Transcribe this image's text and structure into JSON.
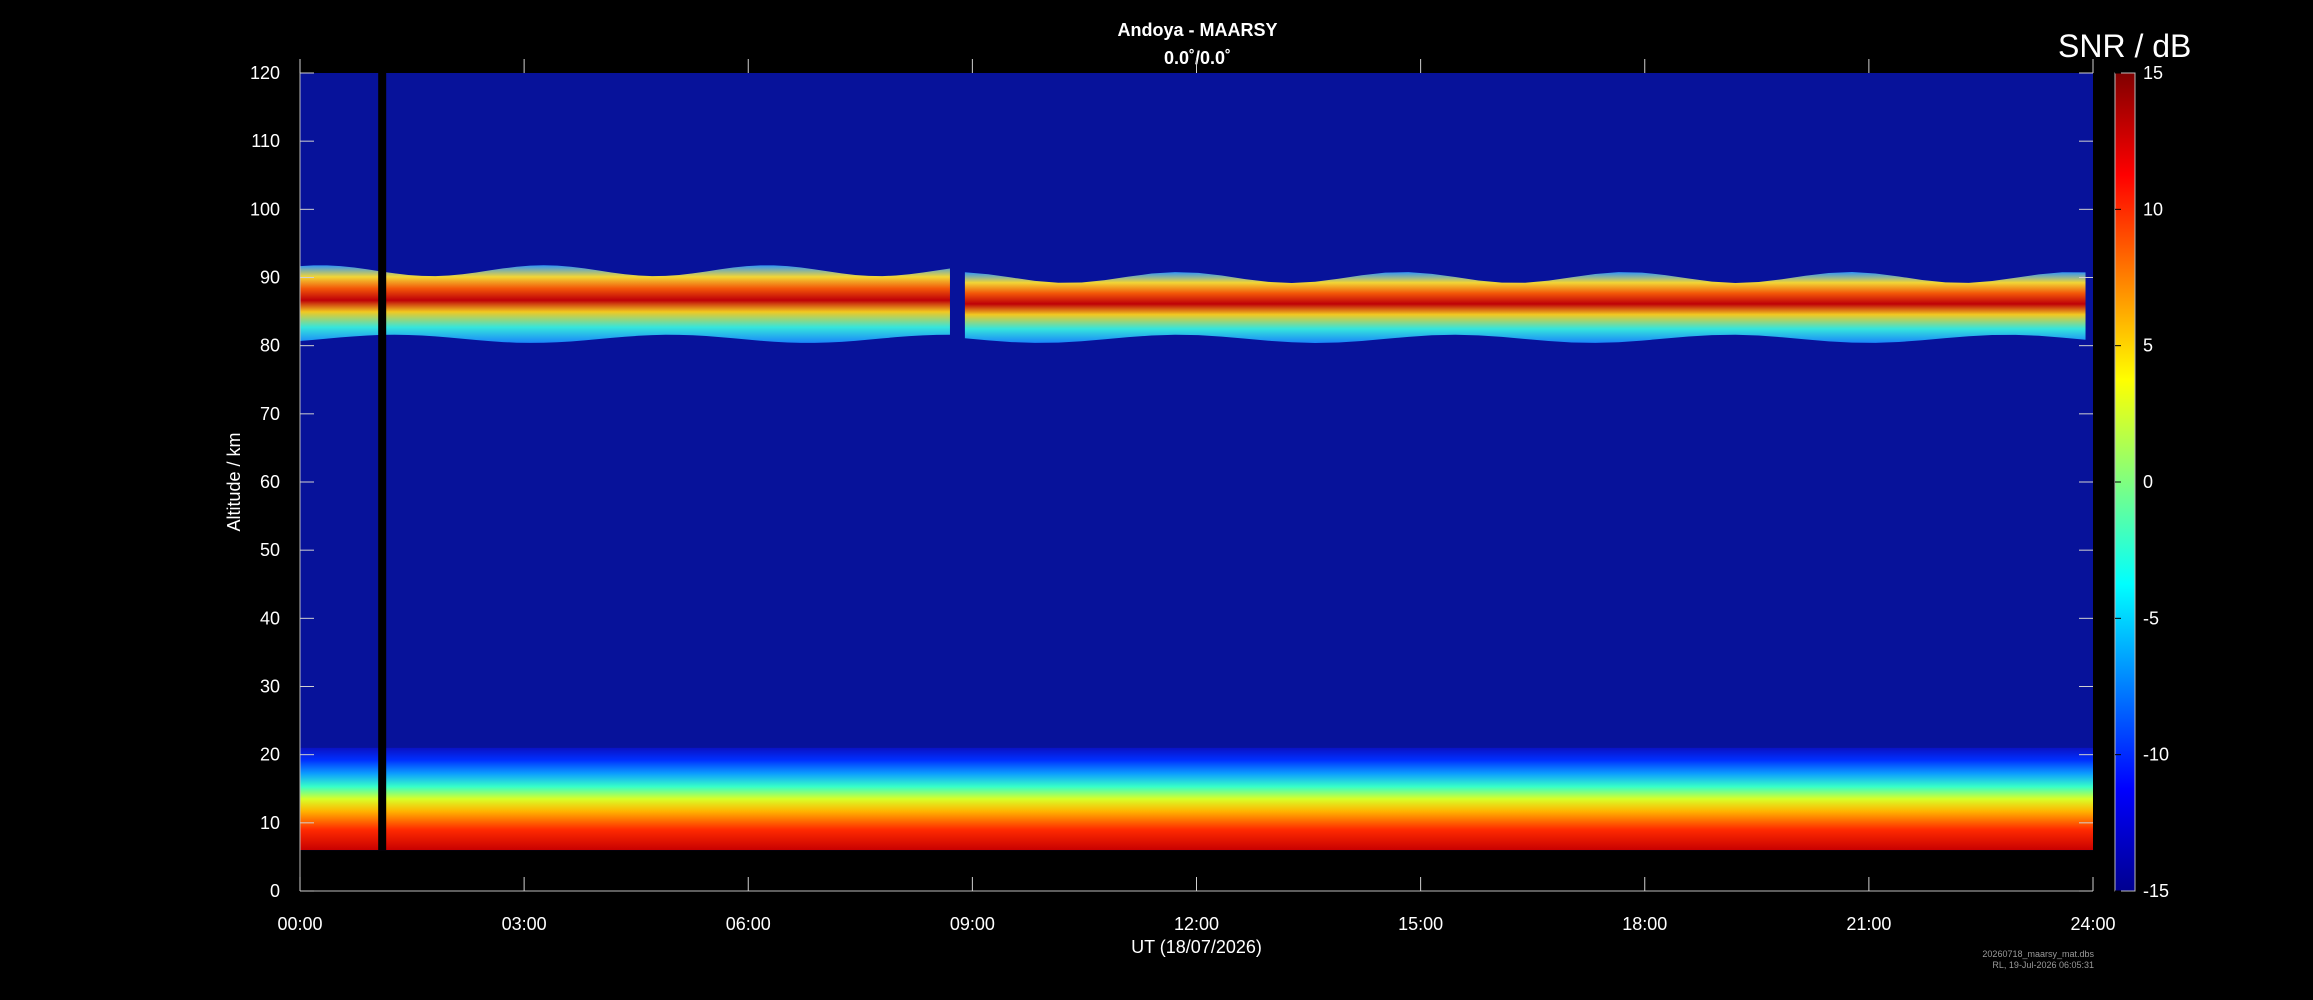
{
  "chart_data": {
    "type": "heatmap",
    "title": "Andoya - MAARSY",
    "subtitle": "0.0˚/0.0˚",
    "xlabel": "UT (18/07/2026)",
    "ylabel": "Altitude / km",
    "x_ticks": [
      "00:00",
      "03:00",
      "06:00",
      "09:00",
      "12:00",
      "15:00",
      "18:00",
      "21:00",
      "24:00"
    ],
    "x_range_hours": [
      0,
      24
    ],
    "y_ticks": [
      0,
      10,
      20,
      30,
      40,
      50,
      60,
      70,
      80,
      90,
      100,
      110,
      120
    ],
    "ylim": [
      0,
      120
    ],
    "colorbar": {
      "label": "SNR / dB",
      "ticks": [
        15,
        10,
        5,
        0,
        -5,
        -10,
        -15
      ],
      "range": [
        -15,
        15
      ],
      "colormap": "jet"
    },
    "features": [
      {
        "description": "data gap",
        "time_h": 1.1,
        "alt_range_km": [
          6,
          120
        ]
      },
      {
        "description": "PMSE layer",
        "time_h": [
          0,
          8.7
        ],
        "alt_range_km": [
          81,
          91
        ]
      },
      {
        "description": "PMSE layer",
        "time_h": [
          8.9,
          23.9
        ],
        "alt_range_km": [
          81,
          90
        ]
      },
      {
        "description": "lower atmosphere echoes",
        "time_h": [
          0,
          24
        ],
        "alt_range_km": [
          6,
          21
        ]
      }
    ]
  },
  "footer": {
    "line1": "20260718_maarsy_mat.dbs",
    "line2": "RL, 19-Jul-2026 06:05:31"
  }
}
